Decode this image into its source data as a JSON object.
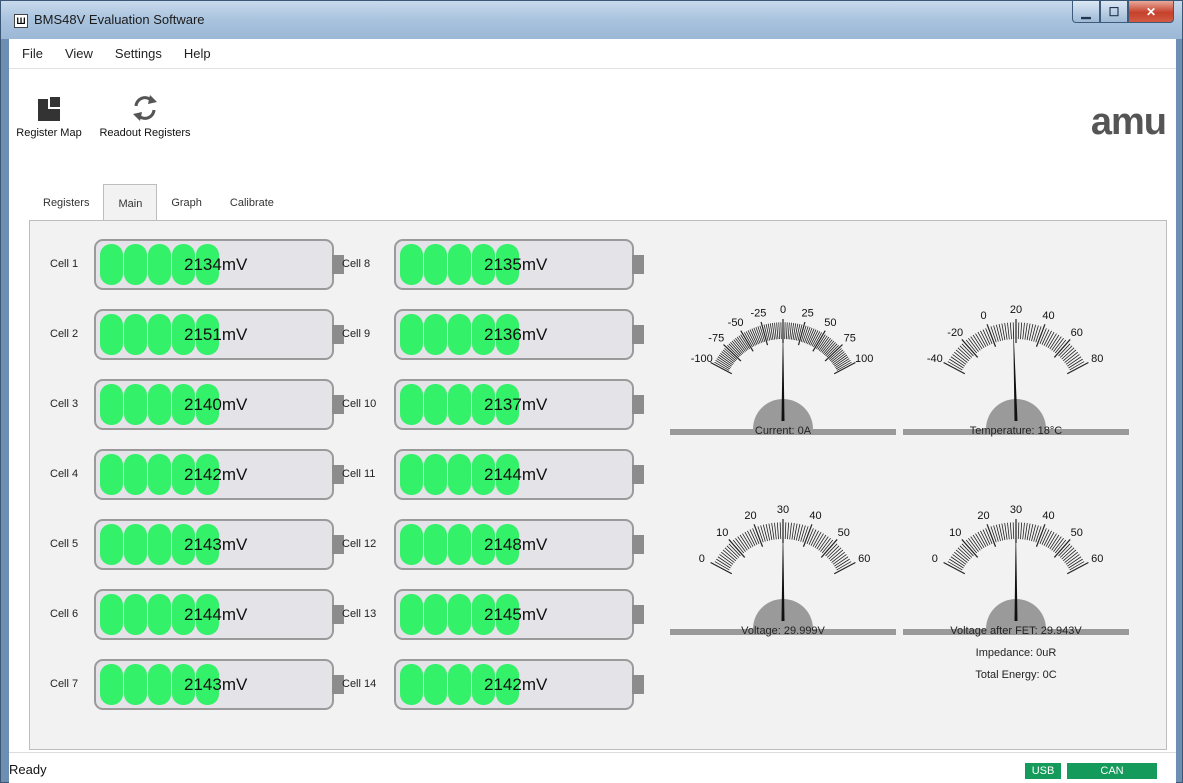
{
  "window": {
    "title": "BMS48V Evaluation Software",
    "icon": "am-app-icon"
  },
  "menu": {
    "items": [
      "File",
      "View",
      "Settings",
      "Help"
    ]
  },
  "toolbar": {
    "register_map": "Register Map",
    "readout_registers": "Readout Registers",
    "logo": "amu"
  },
  "tabs": [
    "Registers",
    "Main",
    "Graph",
    "Calibrate"
  ],
  "active_tab": "Main",
  "cells": {
    "left": [
      {
        "label": "Cell 1",
        "value": "2134mV"
      },
      {
        "label": "Cell 2",
        "value": "2151mV"
      },
      {
        "label": "Cell 3",
        "value": "2140mV"
      },
      {
        "label": "Cell 4",
        "value": "2142mV"
      },
      {
        "label": "Cell 5",
        "value": "2143mV"
      },
      {
        "label": "Cell 6",
        "value": "2144mV"
      },
      {
        "label": "Cell 7",
        "value": "2143mV"
      }
    ],
    "right": [
      {
        "label": "Cell 8",
        "value": "2135mV"
      },
      {
        "label": "Cell 9",
        "value": "2136mV"
      },
      {
        "label": "Cell 10",
        "value": "2137mV"
      },
      {
        "label": "Cell 11",
        "value": "2144mV"
      },
      {
        "label": "Cell 12",
        "value": "2148mV"
      },
      {
        "label": "Cell 13",
        "value": "2145mV"
      },
      {
        "label": "Cell 14",
        "value": "2142mV"
      }
    ],
    "fill_segments": 5,
    "fill_color": "#34f16a"
  },
  "gauges": {
    "current": {
      "caption": "Current: 0A",
      "ticks": [
        "-100",
        "-75",
        "-50",
        "-25",
        "0",
        "25",
        "50",
        "75",
        "100"
      ],
      "min": -100,
      "max": 100,
      "value": 0
    },
    "temperature": {
      "caption": "Temperature: 18°C",
      "ticks": [
        "-40",
        "-20",
        "0",
        "20",
        "40",
        "60",
        "80"
      ],
      "min": -40,
      "max": 80,
      "value": 18
    },
    "voltage": {
      "caption": "Voltage: 29.999V",
      "ticks": [
        "0",
        "10",
        "20",
        "30",
        "40",
        "50",
        "60"
      ],
      "min": 0,
      "max": 60,
      "value": 29.999
    },
    "voltage_fet": {
      "caption": "Voltage after FET: 29.943V",
      "ticks": [
        "0",
        "10",
        "20",
        "30",
        "40",
        "50",
        "60"
      ],
      "min": 0,
      "max": 60,
      "value": 29.943
    }
  },
  "info": {
    "impedance": "Impedance: 0uR",
    "total_energy": "Total Energy: 0C"
  },
  "status": {
    "text": "Ready",
    "usb": "USB",
    "can": "CAN",
    "indicator_color": "#149a5a"
  }
}
